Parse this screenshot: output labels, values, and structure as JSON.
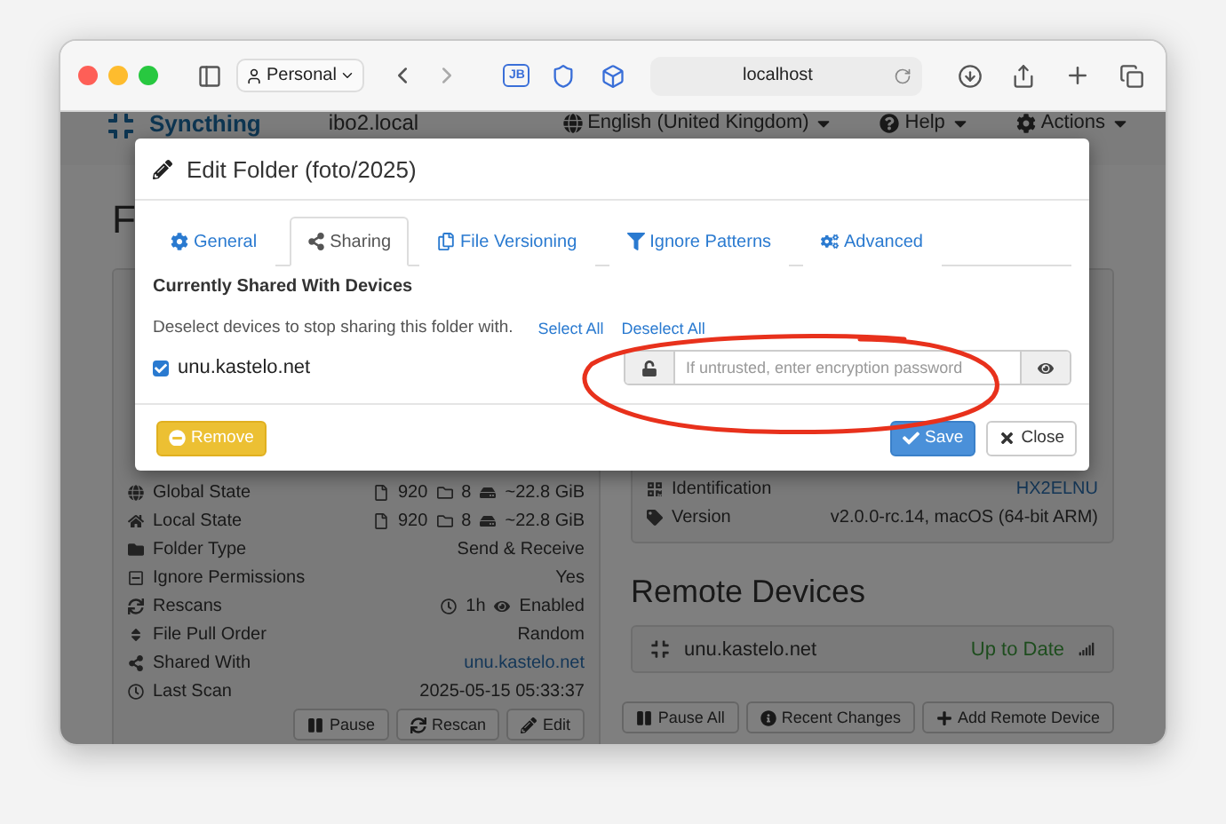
{
  "browser": {
    "profile": "Personal",
    "extension_label": "JB",
    "url": "localhost"
  },
  "navbar": {
    "brand": "Syncthing",
    "device": "ibo2.local",
    "menus": [
      {
        "label": "English (United Kingdom)"
      },
      {
        "label": "Help"
      },
      {
        "label": "Actions"
      }
    ]
  },
  "folders_heading": "F",
  "folder_details": [
    {
      "kind": "stats",
      "label": "Global State",
      "files": "920",
      "dirs": "8",
      "size": "~22.8 GiB"
    },
    {
      "kind": "stats",
      "label": "Local State",
      "files": "920",
      "dirs": "8",
      "size": "~22.8 GiB"
    },
    {
      "kind": "text",
      "label": "Folder Type",
      "value": "Send & Receive"
    },
    {
      "kind": "text",
      "label": "Ignore Permissions",
      "value": "Yes"
    },
    {
      "kind": "rescan",
      "label": "Rescans",
      "interval": "1h",
      "watcher": "Enabled"
    },
    {
      "kind": "text",
      "label": "File Pull Order",
      "value": "Random"
    },
    {
      "kind": "link",
      "label": "Shared With",
      "value": "unu.kastelo.net"
    },
    {
      "kind": "text",
      "label": "Last Scan",
      "value": "2025-05-15 05:33:37"
    }
  ],
  "folder_buttons": [
    "Pause",
    "Rescan",
    "Edit"
  ],
  "device_details": [
    {
      "kind": "link",
      "label": "Identification",
      "value": "HX2ELNU"
    },
    {
      "kind": "text",
      "label": "Version",
      "value": "v2.0.0-rc.14, macOS (64-bit ARM)"
    }
  ],
  "remote_devices": {
    "title": "Remote Devices",
    "devices": [
      {
        "name": "unu.kastelo.net",
        "status": "Up to Date"
      }
    ],
    "buttons": [
      "Pause All",
      "Recent Changes",
      "Add Remote Device"
    ]
  },
  "modal": {
    "title": "Edit Folder (foto/2025)",
    "tabs": [
      {
        "label": "General",
        "selected": false
      },
      {
        "label": "Sharing",
        "selected": true
      },
      {
        "label": "File Versioning",
        "selected": false
      },
      {
        "label": "Ignore Patterns",
        "selected": false
      },
      {
        "label": "Advanced",
        "selected": false
      }
    ],
    "section_title": "Currently Shared With Devices",
    "hint": "Deselect devices to stop sharing this folder with.",
    "links": [
      "Select All",
      "Deselect All"
    ],
    "devices": [
      {
        "name": "unu.kastelo.net",
        "checked": true,
        "password_placeholder": "If untrusted, enter encryption password"
      }
    ],
    "buttons": [
      {
        "kind": "danger",
        "label": "Remove"
      },
      {
        "kind": "primary",
        "label": "Save"
      },
      {
        "kind": "default",
        "label": "Close"
      }
    ]
  }
}
